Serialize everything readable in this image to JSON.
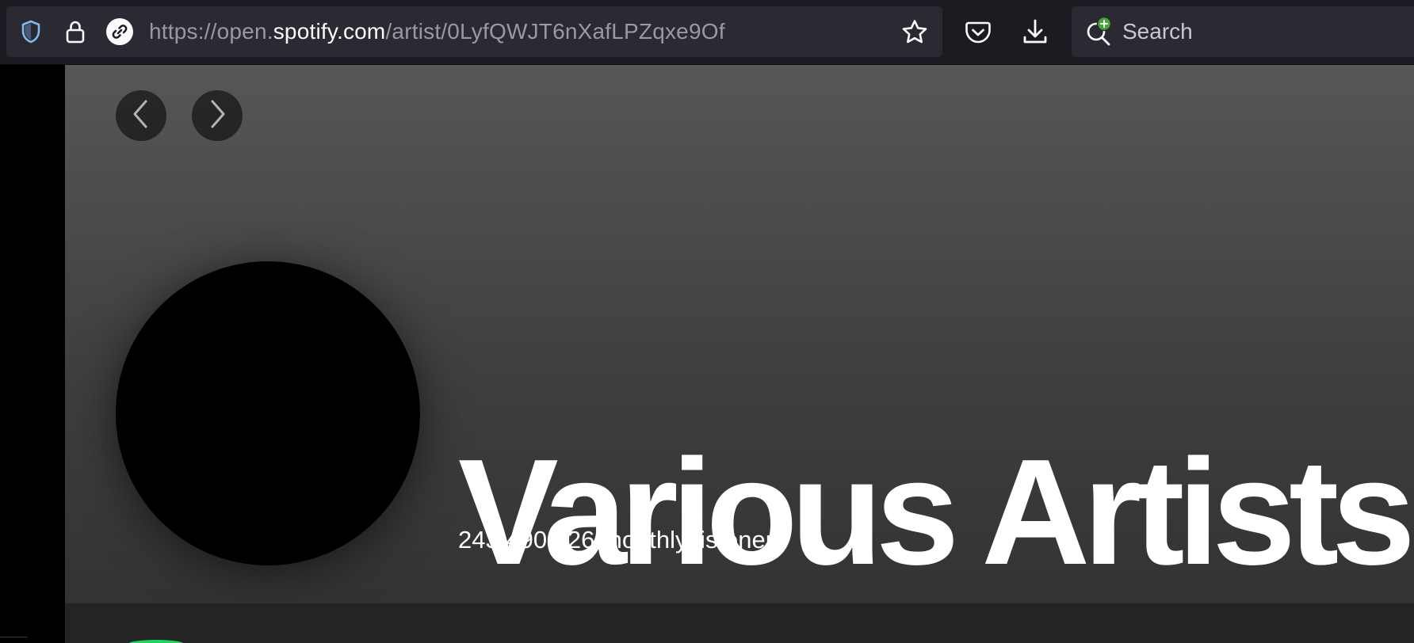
{
  "browser": {
    "url_prefix": "https://open.",
    "url_host": "spotify.com",
    "url_path": "/artist/0LyfQWJT6nXafLPZqxe9Of",
    "search_placeholder": "Search",
    "icons": {
      "shield": "shield-icon",
      "lock": "lock-icon",
      "link": "link-icon",
      "star": "star-icon",
      "pocket": "pocket-icon",
      "download": "download-icon",
      "search": "search-icon"
    }
  },
  "page": {
    "nav": {
      "back_icon": "chevron-left-icon",
      "forward_icon": "chevron-right-icon"
    },
    "artist": {
      "name": "Various Artists",
      "monthly_listeners": "243,490,226 monthly listeners"
    }
  },
  "colors": {
    "toolbar_bg": "#1c1b22",
    "urlbar_bg": "#2b2a33",
    "hero_top": "#575757",
    "hero_bottom": "#333333",
    "spotify_green": "#1ed760",
    "shield_blue": "#80b9ee"
  }
}
